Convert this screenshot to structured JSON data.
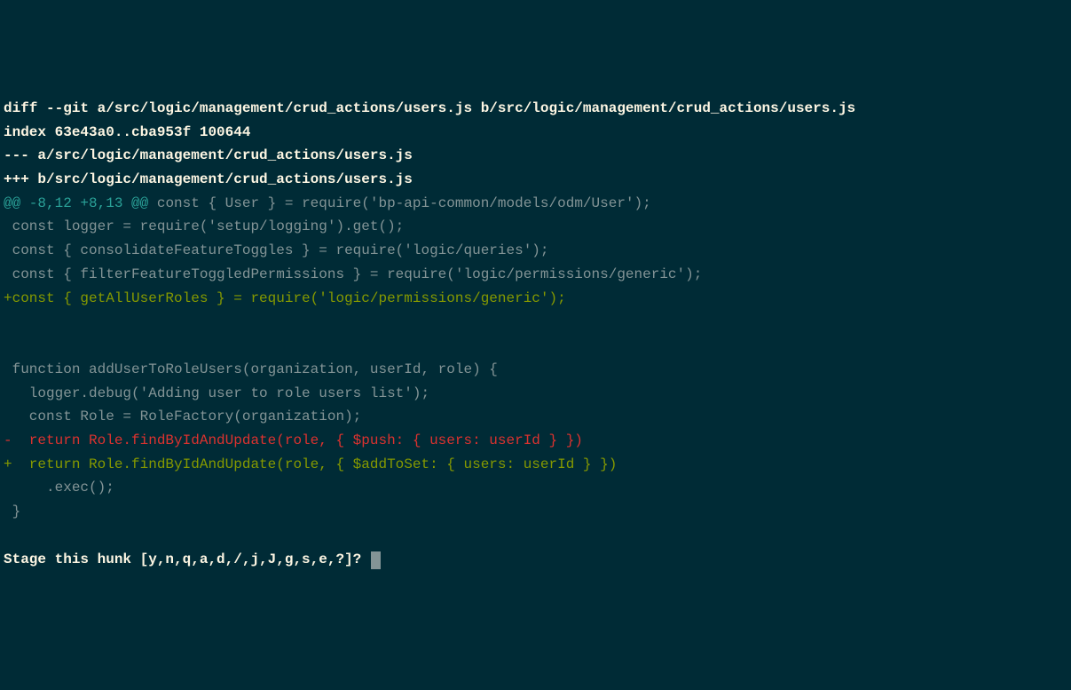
{
  "diff": {
    "header_line": "diff --git a/src/logic/management/crud_actions/users.js b/src/logic/management/crud_actions/users.js",
    "index_line": "index 63e43a0..cba953f 100644",
    "old_file": "--- a/src/logic/management/crud_actions/users.js",
    "new_file": "+++ b/src/logic/management/crud_actions/users.js",
    "hunk_header_range": "@@ -8,12 +8,13 @@",
    "hunk_header_context": " const { User } = require('bp-api-common/models/odm/User');",
    "context1": " const logger = require('setup/logging').get();",
    "context2": " const { consolidateFeatureToggles } = require('logic/queries');",
    "context3": " const { filterFeatureToggledPermissions } = require('logic/permissions/generic');",
    "added1": "+const { getAllUserRoles } = require('logic/permissions/generic');",
    "blank1": " ",
    "blank2": " ",
    "context4": " function addUserToRoleUsers(organization, userId, role) {",
    "context5": "   logger.debug('Adding user to role users list');",
    "context6": "   const Role = RoleFactory(organization);",
    "removed1": "-  return Role.findByIdAndUpdate(role, { $push: { users: userId } })",
    "added2": "+  return Role.findByIdAndUpdate(role, { $addToSet: { users: userId } })",
    "context7": "     .exec();",
    "context8": " }",
    "blank3": " "
  },
  "prompt": {
    "text": "Stage this hunk [y,n,q,a,d,/,j,J,g,s,e,?]?"
  }
}
